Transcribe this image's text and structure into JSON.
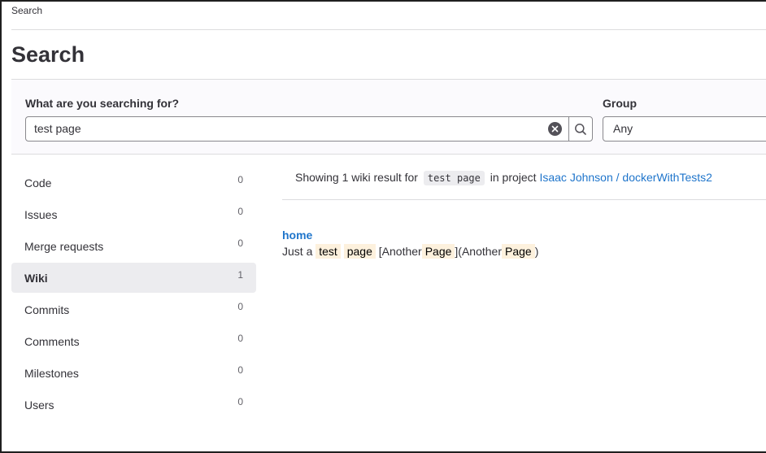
{
  "breadcrumb": {
    "label": "Search"
  },
  "page": {
    "title": "Search"
  },
  "search": {
    "label": "What are you searching for?",
    "value": "test page",
    "clear_icon": "close-circle-icon",
    "submit_icon": "search-icon"
  },
  "group": {
    "label": "Group",
    "value": "Any"
  },
  "sidebar": {
    "items": [
      {
        "label": "Code",
        "count": "0",
        "active": false
      },
      {
        "label": "Issues",
        "count": "0",
        "active": false
      },
      {
        "label": "Merge requests",
        "count": "0",
        "active": false
      },
      {
        "label": "Wiki",
        "count": "1",
        "active": true
      },
      {
        "label": "Commits",
        "count": "0",
        "active": false
      },
      {
        "label": "Comments",
        "count": "0",
        "active": false
      },
      {
        "label": "Milestones",
        "count": "0",
        "active": false
      },
      {
        "label": "Users",
        "count": "0",
        "active": false
      }
    ]
  },
  "results": {
    "summary_prefix": "Showing 1 wiki result for",
    "query": "test page",
    "summary_middle": "in project",
    "project": "Isaac Johnson / dockerWithTests2",
    "items": [
      {
        "title": "home",
        "excerpt": {
          "t1": "Just a",
          "h1": "test",
          "h2": "page",
          "t2": "[Another",
          "h3": "Page",
          "t3": "](Another",
          "h4": "Page",
          "t4": ")"
        }
      }
    ]
  },
  "colors": {
    "link": "#1f75cb",
    "highlight": "#fdf1dd",
    "active_nav": "#ececef",
    "text": "#333238"
  }
}
